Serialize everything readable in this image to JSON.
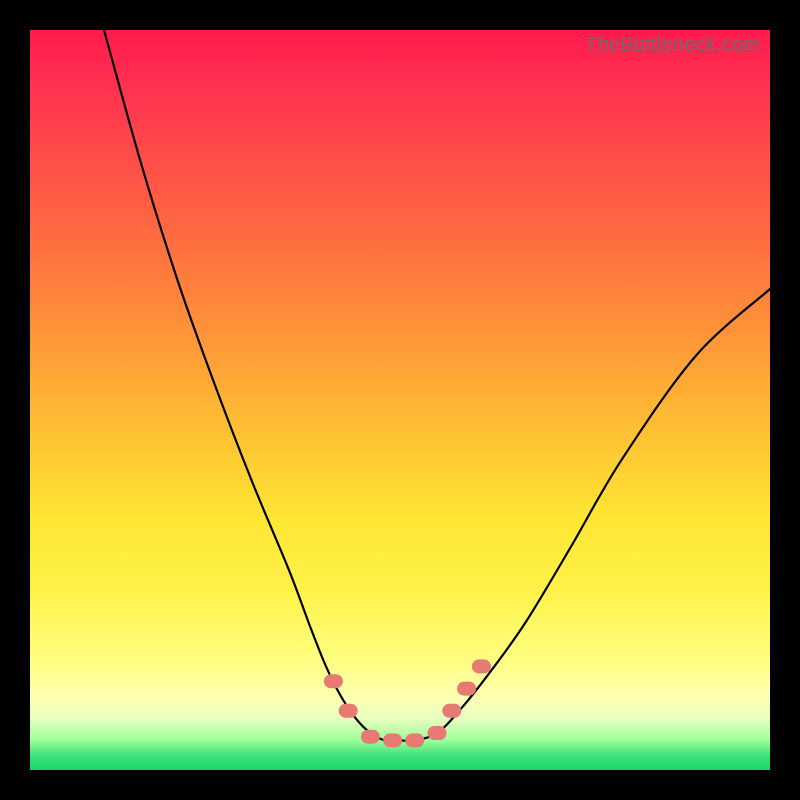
{
  "watermark": "TheBottleneck.com",
  "colors": {
    "frame": "#000000",
    "marker": "#e77a72",
    "curve": "#000000",
    "gradient_stops": [
      "#ff1a4d",
      "#ff5a45",
      "#ffb933",
      "#fff24a",
      "#ffffb0",
      "#3fe27a"
    ]
  },
  "chart_data": {
    "type": "line",
    "title": "",
    "xlabel": "",
    "ylabel": "",
    "xlim": [
      0,
      100
    ],
    "ylim": [
      0,
      100
    ],
    "grid": false,
    "note": "Axes unlabeled; values are percentages estimated from pixel positions. y=0 at bottom, y=100 at top.",
    "series": [
      {
        "name": "curve",
        "x": [
          10,
          15,
          20,
          25,
          30,
          35,
          38,
          40,
          42,
          44,
          46,
          48,
          50,
          52,
          55,
          58,
          62,
          67,
          73,
          80,
          90,
          100
        ],
        "y": [
          100,
          82,
          66,
          52,
          39,
          27,
          19,
          14,
          10,
          7,
          5,
          4,
          4,
          4,
          5,
          8,
          13,
          20,
          30,
          42,
          56,
          65
        ]
      }
    ],
    "markers": {
      "name": "highlight-dots",
      "note": "Salmon capsule markers near the curve minimum",
      "points": [
        {
          "x": 41,
          "y": 12
        },
        {
          "x": 43,
          "y": 8
        },
        {
          "x": 46,
          "y": 4.5
        },
        {
          "x": 49,
          "y": 4
        },
        {
          "x": 52,
          "y": 4
        },
        {
          "x": 55,
          "y": 5
        },
        {
          "x": 57,
          "y": 8
        },
        {
          "x": 59,
          "y": 11
        },
        {
          "x": 61,
          "y": 14
        }
      ]
    }
  }
}
